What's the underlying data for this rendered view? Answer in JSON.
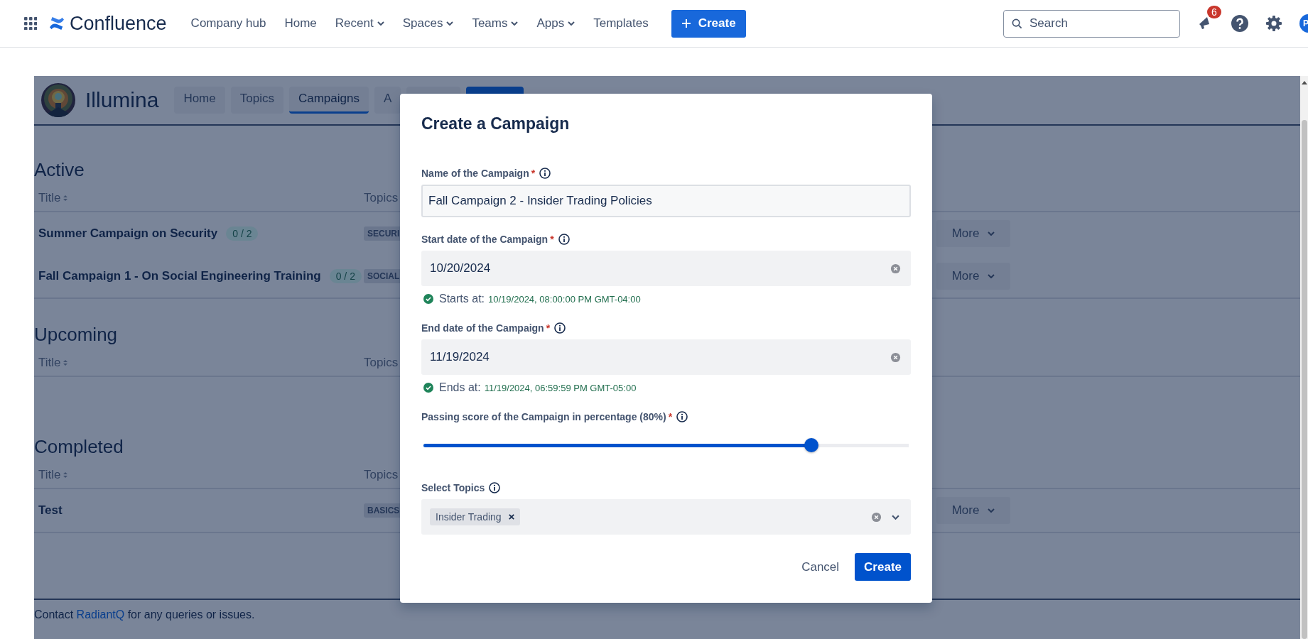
{
  "topnav": {
    "app_name": "Confluence",
    "items": [
      {
        "label": "Company hub",
        "dropdown": false
      },
      {
        "label": "Home",
        "dropdown": false
      },
      {
        "label": "Recent",
        "dropdown": true
      },
      {
        "label": "Spaces",
        "dropdown": true
      },
      {
        "label": "Teams",
        "dropdown": true
      },
      {
        "label": "Apps",
        "dropdown": true
      },
      {
        "label": "Templates",
        "dropdown": false
      }
    ],
    "create_button": "Create",
    "search": {
      "placeholder": "Search"
    },
    "notification_count": "6",
    "avatar_initial": "P"
  },
  "space": {
    "name": "Illumina",
    "tabs": [
      {
        "label": "Home",
        "selected": false
      },
      {
        "label": "Topics",
        "selected": false
      },
      {
        "label": "Campaigns",
        "selected": true
      },
      {
        "label": "A",
        "selected": false
      }
    ]
  },
  "sections": [
    {
      "heading": "Active",
      "columns": [
        "Title",
        "Topics"
      ],
      "rows": [
        {
          "title": "Summer Campaign on Security",
          "progress": "0 / 2",
          "topic": "SECURI",
          "action": "More"
        },
        {
          "title": "Fall Campaign 1 - On Social Engineering Training",
          "progress": "0 / 2",
          "topic": "SOCIAL",
          "action": "More"
        }
      ]
    },
    {
      "heading": "Upcoming",
      "columns": [
        "Title",
        "Topics"
      ]
    },
    {
      "heading": "Completed",
      "columns": [
        "Title",
        "Topics"
      ],
      "rows": [
        {
          "title": "Test",
          "topic": "BASICS",
          "action": "More"
        }
      ]
    }
  ],
  "footer": {
    "before": "Contact",
    "link": "RadiantQ",
    "after": "for any queries or issues."
  },
  "modal": {
    "title": "Create a Campaign",
    "fields": [
      {
        "kind": "text",
        "label": "Name of the Campaign",
        "required": true,
        "value": "Fall Campaign 2 - Insider Trading Policies"
      },
      {
        "kind": "date",
        "label": "Start date of the Campaign",
        "required": true,
        "value": "10/20/2024",
        "note": {
          "prefix": "Starts at:",
          "value": "10/19/2024, 08:00:00 PM GMT-04:00"
        }
      },
      {
        "kind": "date",
        "label": "End date of the Campaign",
        "required": true,
        "value": "11/19/2024",
        "note": {
          "prefix": "Ends at:",
          "value": "11/19/2024, 06:59:59 PM GMT-05:00"
        }
      },
      {
        "kind": "slider",
        "label": "Passing score of the Campaign in percentage (80%)",
        "required": true,
        "level": 0.8
      },
      {
        "kind": "multiselect",
        "label": "Select Topics",
        "required": false,
        "tags": [
          "Insider Trading"
        ]
      }
    ],
    "required_mark": "*",
    "cancel": "Cancel",
    "submit": "Create"
  }
}
